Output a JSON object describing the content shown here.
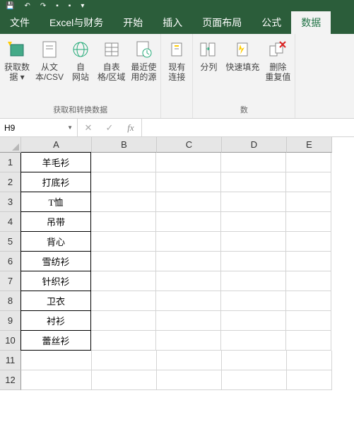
{
  "tabs": {
    "file": "文件",
    "excel_finance": "Excel与财务",
    "home": "开始",
    "insert": "插入",
    "page_layout": "页面布局",
    "formulas": "公式",
    "data": "数据"
  },
  "ribbon": {
    "group1_label": "获取和转换数据",
    "group2_label": "数",
    "get_data": "获取数\n据 ▾",
    "from_csv": "从文\n本/CSV",
    "from_web": "自\n网站",
    "from_table": "自表\n格/区域",
    "recent": "最近使\n用的源",
    "existing": "现有\n连接",
    "columns": "分列",
    "flash_fill": "快速填充",
    "remove_dup": "删除\n重复值"
  },
  "namebox": {
    "value": "H9"
  },
  "fx": {
    "label": "fx"
  },
  "columns": [
    "A",
    "B",
    "C",
    "D",
    "E"
  ],
  "rows": [
    "1",
    "2",
    "3",
    "4",
    "5",
    "6",
    "7",
    "8",
    "9",
    "10",
    "11",
    "12"
  ],
  "cellsA": [
    "羊毛衫",
    "打底衫",
    "T恤",
    "吊带",
    "背心",
    "雪纺衫",
    "针织衫",
    "卫衣",
    "衬衫",
    "蕾丝衫",
    "",
    ""
  ]
}
